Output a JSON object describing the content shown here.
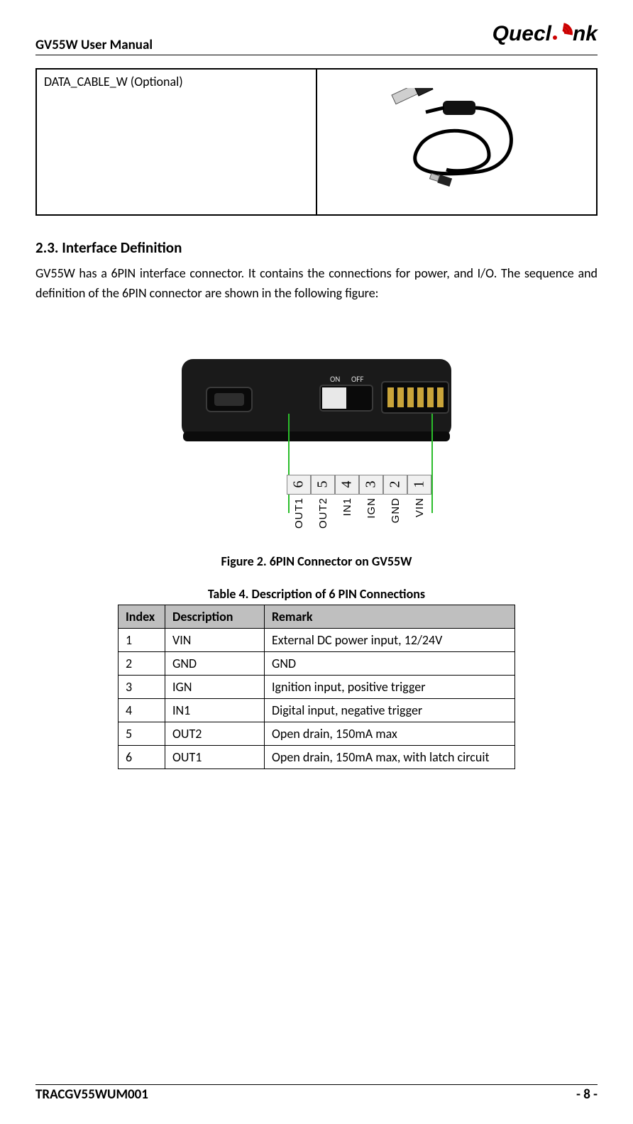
{
  "header": {
    "title": "GV55W User Manual",
    "brand": "Queclink"
  },
  "top_table": {
    "cell_label": "DATA_CABLE_W (Optional)"
  },
  "section": {
    "heading": "2.3. Interface Definition",
    "paragraph": "GV55W has a 6PIN interface connector. It contains the connections for power, and I/O. The sequence and definition of the 6PIN connector are shown in the following figure:"
  },
  "figure_caption": "Figure 2. 6PIN Connector on GV55W",
  "table_caption": "Table 4.   Description of 6 PIN Connections",
  "pin_nums": [
    "6",
    "5",
    "4",
    "3",
    "2",
    "1"
  ],
  "pin_names": [
    "OUT1",
    "OUT2",
    "IN1",
    "IGN",
    "GND",
    "VIN"
  ],
  "on_off": {
    "on": "ON",
    "off": "OFF"
  },
  "pin_table": {
    "headers": {
      "index": "Index",
      "description": "Description",
      "remark": "Remark"
    },
    "rows": [
      {
        "index": "1",
        "description": "VIN",
        "remark": "External DC power input, 12/24V"
      },
      {
        "index": "2",
        "description": "GND",
        "remark": "GND"
      },
      {
        "index": "3",
        "description": "IGN",
        "remark": "Ignition input, positive trigger"
      },
      {
        "index": "4",
        "description": "IN1",
        "remark": "Digital input, negative trigger"
      },
      {
        "index": "5",
        "description": "OUT2",
        "remark": "Open drain, 150mA max"
      },
      {
        "index": "6",
        "description": "OUT1",
        "remark": "Open drain, 150mA max, with latch circuit"
      }
    ]
  },
  "footer": {
    "doc_id": "TRACGV55WUM001",
    "page": "- 8 -"
  }
}
